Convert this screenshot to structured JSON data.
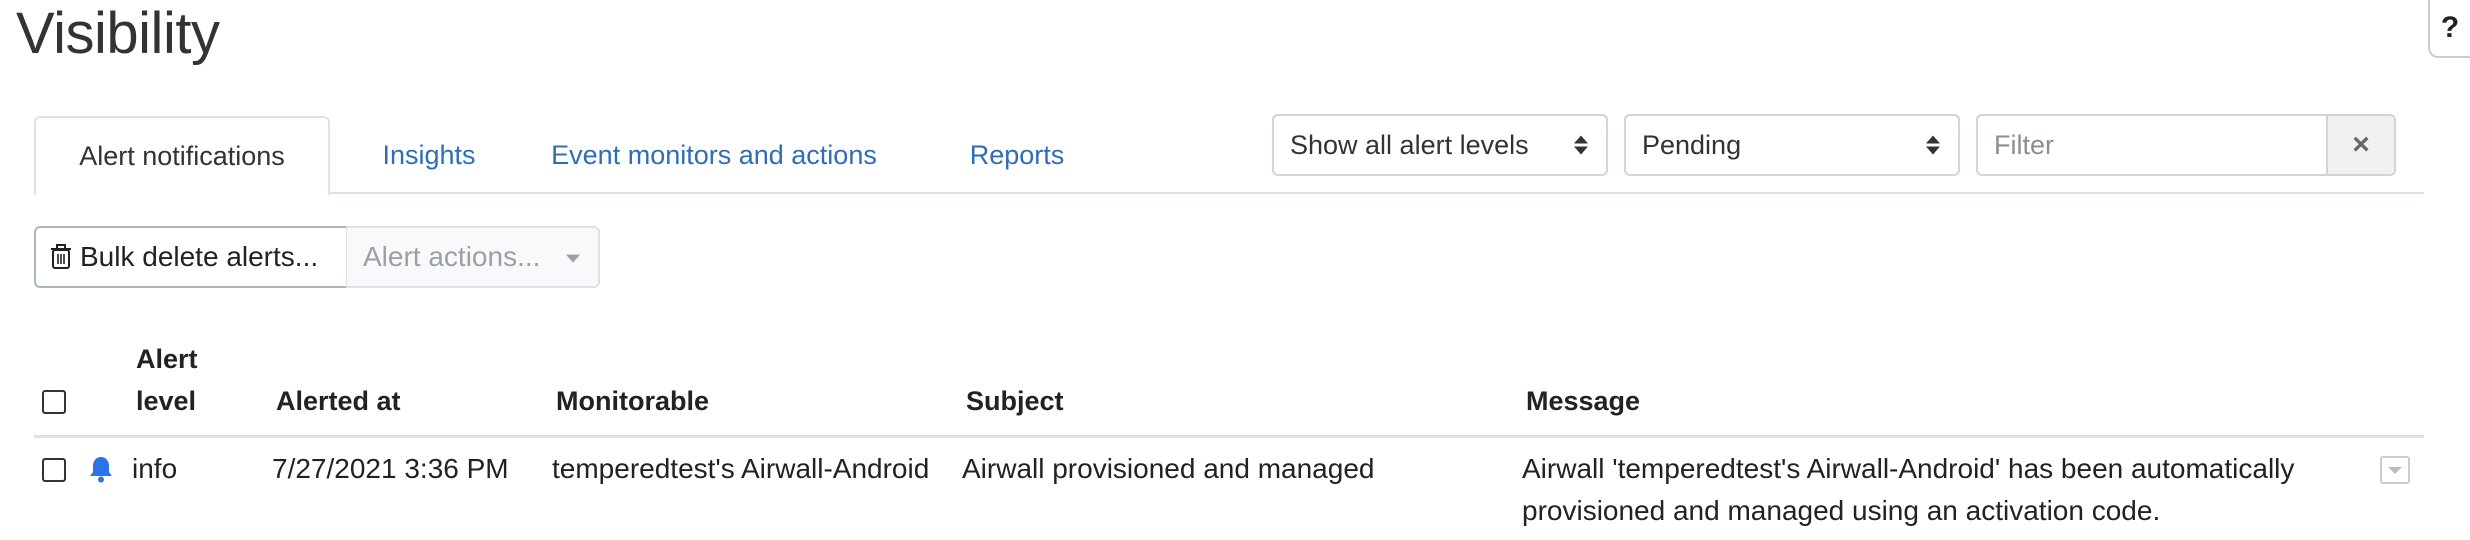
{
  "page": {
    "title": "Visibility",
    "help": "?"
  },
  "tabs": [
    {
      "label": "Alert notifications",
      "active": true
    },
    {
      "label": "Insights",
      "active": false
    },
    {
      "label": "Event monitors and actions",
      "active": false
    },
    {
      "label": "Reports",
      "active": false
    }
  ],
  "filters": {
    "level_select": "Show all alert levels",
    "status_select": "Pending",
    "filter_placeholder": "Filter",
    "clear_icon": "×"
  },
  "toolbar": {
    "bulk_delete_label": "Bulk delete alerts...",
    "bulk_delete_icon": "trash-icon",
    "alert_actions_label": "Alert actions..."
  },
  "table": {
    "columns": {
      "alert_level_line1": "Alert",
      "alert_level_line2": "level",
      "alerted_at": "Alerted at",
      "monitorable": "Monitorable",
      "subject": "Subject",
      "message": "Message"
    },
    "rows": [
      {
        "level": "info",
        "level_icon": "bell-icon",
        "alerted_at": "7/27/2021 3:36 PM",
        "monitorable": "temperedtest's Airwall-Android",
        "subject": "Airwall provisioned and managed",
        "message_line1": "Airwall 'temperedtest's Airwall-Android' has been automatically",
        "message_line2": "provisioned and managed using an activation code."
      }
    ]
  },
  "colors": {
    "link": "#2f6db5",
    "bell": "#2b74e8",
    "border": "#dee2e6"
  }
}
